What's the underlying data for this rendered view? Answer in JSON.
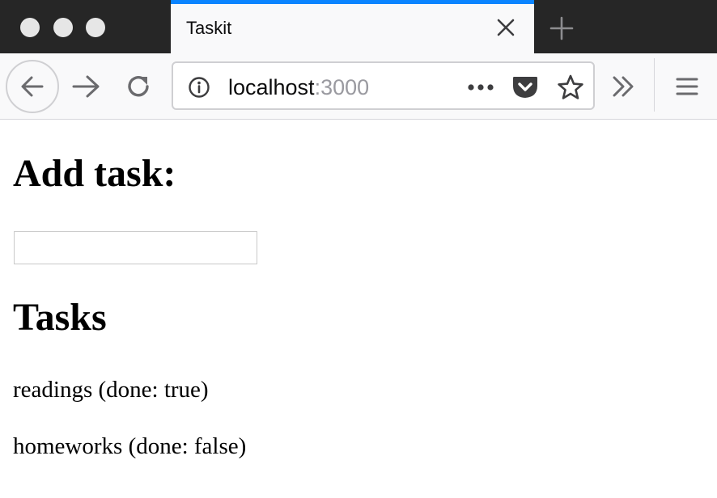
{
  "browser": {
    "tab": {
      "title": "Taskit",
      "accent_color": "#0a84ff"
    },
    "icons": {
      "close_tab": "close-icon",
      "new_tab": "plus-icon",
      "back": "arrow-left-icon",
      "forward": "arrow-right-icon",
      "reload": "reload-icon",
      "site_info": "info-icon",
      "page_actions": "more-horizontal-icon",
      "pocket": "pocket-icon",
      "bookmark": "star-icon",
      "overflow": "chevron-double-right-icon",
      "menu": "hamburger-menu-icon"
    },
    "url": {
      "host": "localhost",
      "port": ":3000"
    }
  },
  "page": {
    "add_heading": "Add task:",
    "task_input": {
      "value": "",
      "placeholder": ""
    },
    "tasks_heading": "Tasks",
    "tasks": [
      {
        "text": "readings (done: true)"
      },
      {
        "text": "homeworks (done: false)"
      }
    ]
  }
}
